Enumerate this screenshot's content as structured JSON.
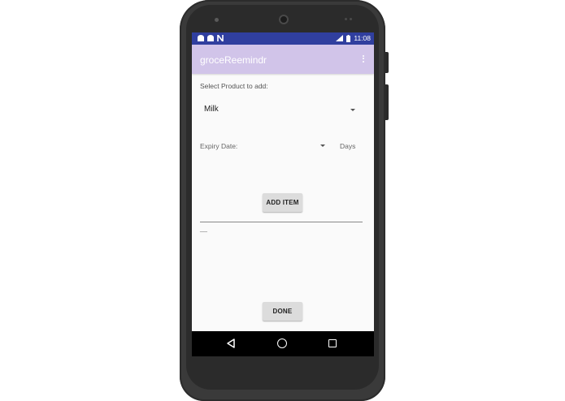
{
  "statusbar": {
    "time": "11:08",
    "icons": [
      "notification-icon",
      "notification-icon",
      "n-icon",
      "signal-icon",
      "battery-icon"
    ]
  },
  "appbar": {
    "title": "groceReemindr",
    "menu_icon": "more-vert-icon"
  },
  "form": {
    "select_label": "Select Product to add:",
    "product_selected": "Milk",
    "expiry_label": "Expiry Date:",
    "days_label": "Days",
    "add_button": "ADD ITEM",
    "list_placeholder": "__",
    "done_button": "DONE"
  },
  "navbar": {
    "icons": [
      "back-icon",
      "home-icon",
      "recents-icon"
    ]
  },
  "colors": {
    "statusbar": "#303f9f",
    "appbar": "#d1c4e9",
    "background": "#fafafa"
  }
}
